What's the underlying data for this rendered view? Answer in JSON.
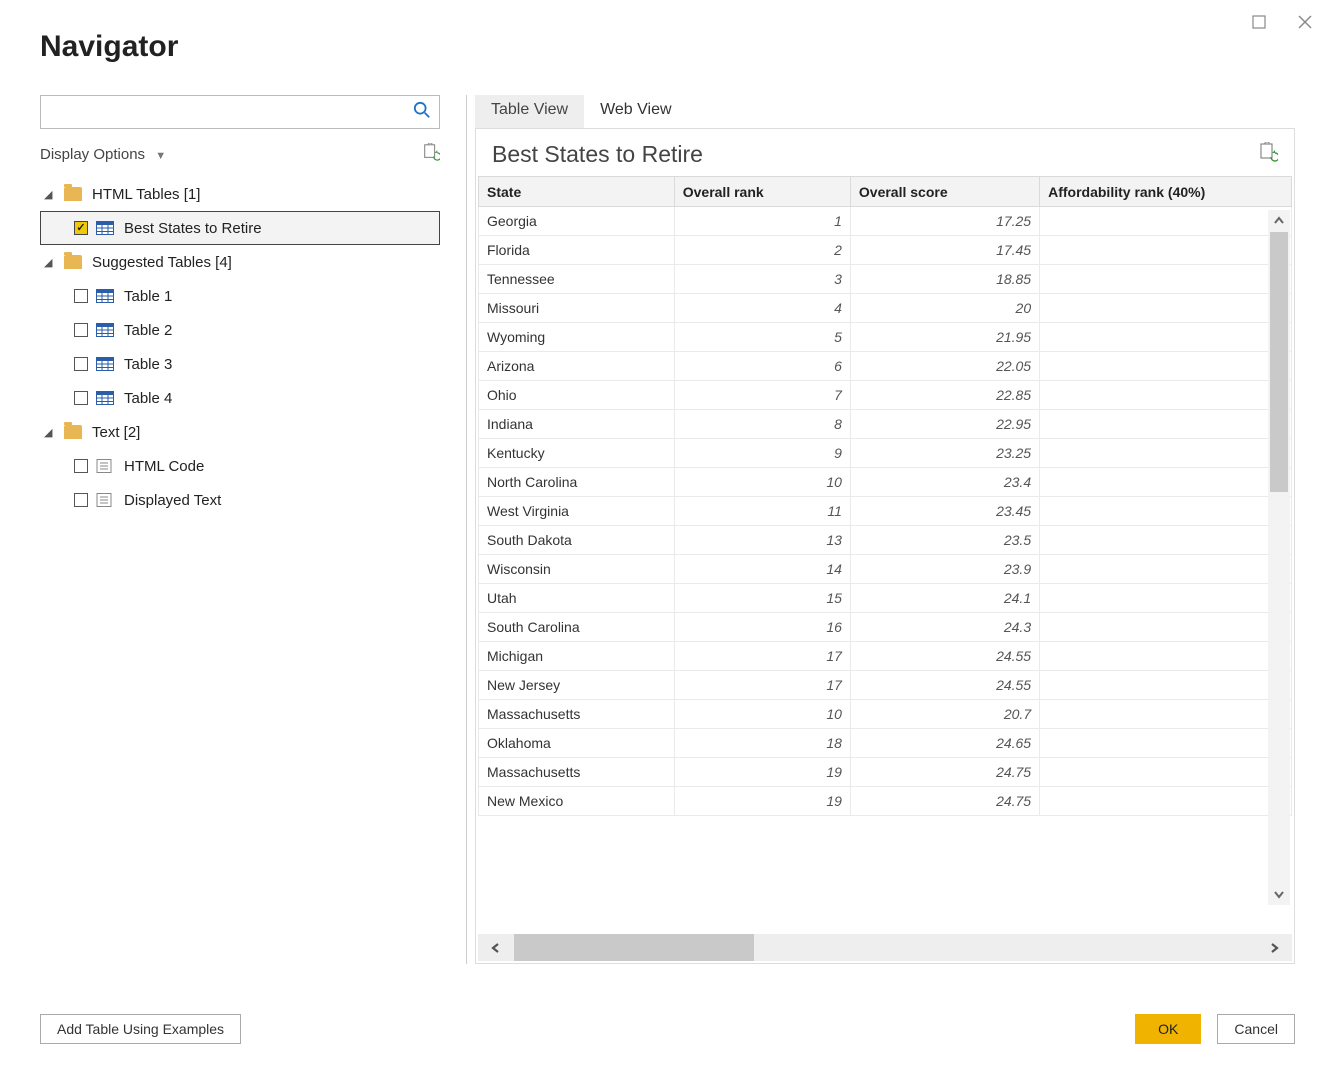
{
  "window": {
    "title": "Navigator"
  },
  "search": {
    "placeholder": ""
  },
  "display_options": {
    "label": "Display Options"
  },
  "tree": {
    "groups": [
      {
        "label": "HTML Tables [1]",
        "items": [
          {
            "label": "Best States to Retire",
            "checked": true,
            "kind": "table",
            "selected": true
          }
        ]
      },
      {
        "label": "Suggested Tables [4]",
        "items": [
          {
            "label": "Table 1",
            "checked": false,
            "kind": "table"
          },
          {
            "label": "Table 2",
            "checked": false,
            "kind": "table"
          },
          {
            "label": "Table 3",
            "checked": false,
            "kind": "table"
          },
          {
            "label": "Table 4",
            "checked": false,
            "kind": "table"
          }
        ]
      },
      {
        "label": "Text [2]",
        "items": [
          {
            "label": "HTML Code",
            "checked": false,
            "kind": "text"
          },
          {
            "label": "Displayed Text",
            "checked": false,
            "kind": "text"
          }
        ]
      }
    ]
  },
  "tabs": {
    "active": "Table View",
    "items": [
      "Table View",
      "Web View"
    ]
  },
  "preview": {
    "title": "Best States to Retire",
    "columns": [
      "State",
      "Overall rank",
      "Overall score",
      "Affordability rank (40%)"
    ],
    "rows": [
      {
        "state": "Georgia",
        "rank": "1",
        "score": "17.25",
        "aff": ""
      },
      {
        "state": "Florida",
        "rank": "2",
        "score": "17.45",
        "aff": ""
      },
      {
        "state": "Tennessee",
        "rank": "3",
        "score": "18.85",
        "aff": ""
      },
      {
        "state": "Missouri",
        "rank": "4",
        "score": "20",
        "aff": ""
      },
      {
        "state": "Wyoming",
        "rank": "5",
        "score": "21.95",
        "aff": ""
      },
      {
        "state": "Arizona",
        "rank": "6",
        "score": "22.05",
        "aff": ""
      },
      {
        "state": "Ohio",
        "rank": "7",
        "score": "22.85",
        "aff": ""
      },
      {
        "state": "Indiana",
        "rank": "8",
        "score": "22.95",
        "aff": ""
      },
      {
        "state": "Kentucky",
        "rank": "9",
        "score": "23.25",
        "aff": ""
      },
      {
        "state": "North Carolina",
        "rank": "10",
        "score": "23.4",
        "aff": ""
      },
      {
        "state": "West Virginia",
        "rank": "11",
        "score": "23.45",
        "aff": ""
      },
      {
        "state": "South Dakota",
        "rank": "13",
        "score": "23.5",
        "aff": ""
      },
      {
        "state": "Wisconsin",
        "rank": "14",
        "score": "23.9",
        "aff": ""
      },
      {
        "state": "Utah",
        "rank": "15",
        "score": "24.1",
        "aff": ""
      },
      {
        "state": "South Carolina",
        "rank": "16",
        "score": "24.3",
        "aff": ""
      },
      {
        "state": "Michigan",
        "rank": "17",
        "score": "24.55",
        "aff": ""
      },
      {
        "state": "New Jersey",
        "rank": "17",
        "score": "24.55",
        "aff": ""
      },
      {
        "state": "Massachusetts",
        "rank": "10",
        "score": "20.7",
        "aff": ""
      },
      {
        "state": "Oklahoma",
        "rank": "18",
        "score": "24.65",
        "aff": ""
      },
      {
        "state": "Massachusetts",
        "rank": "19",
        "score": "24.75",
        "aff": ""
      },
      {
        "state": "New Mexico",
        "rank": "19",
        "score": "24.75",
        "aff": ""
      }
    ]
  },
  "footer": {
    "add_examples": "Add Table Using Examples",
    "ok": "OK",
    "cancel": "Cancel"
  }
}
